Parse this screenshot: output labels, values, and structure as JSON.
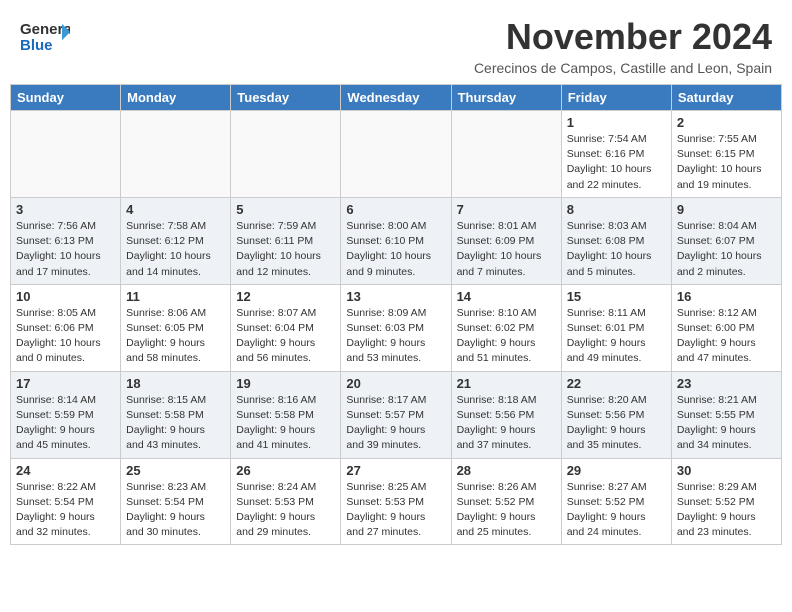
{
  "header": {
    "logo_line1": "General",
    "logo_line2": "Blue",
    "month": "November 2024",
    "location": "Cerecinos de Campos, Castille and Leon, Spain"
  },
  "weekdays": [
    "Sunday",
    "Monday",
    "Tuesday",
    "Wednesday",
    "Thursday",
    "Friday",
    "Saturday"
  ],
  "rows": [
    {
      "cells": [
        {
          "empty": true
        },
        {
          "empty": true
        },
        {
          "empty": true
        },
        {
          "empty": true
        },
        {
          "empty": true
        },
        {
          "day": "1",
          "info": "Sunrise: 7:54 AM\nSunset: 6:16 PM\nDaylight: 10 hours\nand 22 minutes."
        },
        {
          "day": "2",
          "info": "Sunrise: 7:55 AM\nSunset: 6:15 PM\nDaylight: 10 hours\nand 19 minutes."
        }
      ]
    },
    {
      "cells": [
        {
          "day": "3",
          "info": "Sunrise: 7:56 AM\nSunset: 6:13 PM\nDaylight: 10 hours\nand 17 minutes."
        },
        {
          "day": "4",
          "info": "Sunrise: 7:58 AM\nSunset: 6:12 PM\nDaylight: 10 hours\nand 14 minutes."
        },
        {
          "day": "5",
          "info": "Sunrise: 7:59 AM\nSunset: 6:11 PM\nDaylight: 10 hours\nand 12 minutes."
        },
        {
          "day": "6",
          "info": "Sunrise: 8:00 AM\nSunset: 6:10 PM\nDaylight: 10 hours\nand 9 minutes."
        },
        {
          "day": "7",
          "info": "Sunrise: 8:01 AM\nSunset: 6:09 PM\nDaylight: 10 hours\nand 7 minutes."
        },
        {
          "day": "8",
          "info": "Sunrise: 8:03 AM\nSunset: 6:08 PM\nDaylight: 10 hours\nand 5 minutes."
        },
        {
          "day": "9",
          "info": "Sunrise: 8:04 AM\nSunset: 6:07 PM\nDaylight: 10 hours\nand 2 minutes."
        }
      ]
    },
    {
      "cells": [
        {
          "day": "10",
          "info": "Sunrise: 8:05 AM\nSunset: 6:06 PM\nDaylight: 10 hours\nand 0 minutes."
        },
        {
          "day": "11",
          "info": "Sunrise: 8:06 AM\nSunset: 6:05 PM\nDaylight: 9 hours\nand 58 minutes."
        },
        {
          "day": "12",
          "info": "Sunrise: 8:07 AM\nSunset: 6:04 PM\nDaylight: 9 hours\nand 56 minutes."
        },
        {
          "day": "13",
          "info": "Sunrise: 8:09 AM\nSunset: 6:03 PM\nDaylight: 9 hours\nand 53 minutes."
        },
        {
          "day": "14",
          "info": "Sunrise: 8:10 AM\nSunset: 6:02 PM\nDaylight: 9 hours\nand 51 minutes."
        },
        {
          "day": "15",
          "info": "Sunrise: 8:11 AM\nSunset: 6:01 PM\nDaylight: 9 hours\nand 49 minutes."
        },
        {
          "day": "16",
          "info": "Sunrise: 8:12 AM\nSunset: 6:00 PM\nDaylight: 9 hours\nand 47 minutes."
        }
      ]
    },
    {
      "cells": [
        {
          "day": "17",
          "info": "Sunrise: 8:14 AM\nSunset: 5:59 PM\nDaylight: 9 hours\nand 45 minutes."
        },
        {
          "day": "18",
          "info": "Sunrise: 8:15 AM\nSunset: 5:58 PM\nDaylight: 9 hours\nand 43 minutes."
        },
        {
          "day": "19",
          "info": "Sunrise: 8:16 AM\nSunset: 5:58 PM\nDaylight: 9 hours\nand 41 minutes."
        },
        {
          "day": "20",
          "info": "Sunrise: 8:17 AM\nSunset: 5:57 PM\nDaylight: 9 hours\nand 39 minutes."
        },
        {
          "day": "21",
          "info": "Sunrise: 8:18 AM\nSunset: 5:56 PM\nDaylight: 9 hours\nand 37 minutes."
        },
        {
          "day": "22",
          "info": "Sunrise: 8:20 AM\nSunset: 5:56 PM\nDaylight: 9 hours\nand 35 minutes."
        },
        {
          "day": "23",
          "info": "Sunrise: 8:21 AM\nSunset: 5:55 PM\nDaylight: 9 hours\nand 34 minutes."
        }
      ]
    },
    {
      "cells": [
        {
          "day": "24",
          "info": "Sunrise: 8:22 AM\nSunset: 5:54 PM\nDaylight: 9 hours\nand 32 minutes."
        },
        {
          "day": "25",
          "info": "Sunrise: 8:23 AM\nSunset: 5:54 PM\nDaylight: 9 hours\nand 30 minutes."
        },
        {
          "day": "26",
          "info": "Sunrise: 8:24 AM\nSunset: 5:53 PM\nDaylight: 9 hours\nand 29 minutes."
        },
        {
          "day": "27",
          "info": "Sunrise: 8:25 AM\nSunset: 5:53 PM\nDaylight: 9 hours\nand 27 minutes."
        },
        {
          "day": "28",
          "info": "Sunrise: 8:26 AM\nSunset: 5:52 PM\nDaylight: 9 hours\nand 25 minutes."
        },
        {
          "day": "29",
          "info": "Sunrise: 8:27 AM\nSunset: 5:52 PM\nDaylight: 9 hours\nand 24 minutes."
        },
        {
          "day": "30",
          "info": "Sunrise: 8:29 AM\nSunset: 5:52 PM\nDaylight: 9 hours\nand 23 minutes."
        }
      ]
    }
  ]
}
